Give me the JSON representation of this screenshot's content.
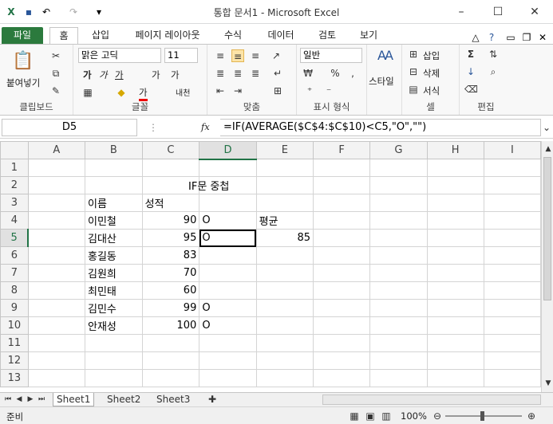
{
  "window": {
    "title": "통합 문서1  -  Microsoft Excel"
  },
  "tabs": [
    "파일",
    "홈",
    "삽입",
    "페이지 레이아웃",
    "수식",
    "데이터",
    "검토",
    "보기"
  ],
  "ribbon": {
    "clipboard": {
      "paste": "붙여넣기",
      "label": "클립보드"
    },
    "font": {
      "name": "맑은 고딕",
      "size": "11",
      "bold": "가",
      "italic": "가",
      "underline": "가",
      "grow": "가",
      "shrink": "가",
      "fontcolor": "가",
      "phonetic": "내천",
      "label": "글꼴"
    },
    "align": {
      "label": "맞춤"
    },
    "number": {
      "format": "일반",
      "label": "표시 형식"
    },
    "styles": {
      "button": "스타일"
    },
    "cells": {
      "insert": "삽입",
      "delete": "삭제",
      "format": "서식",
      "label": "셀"
    },
    "editing": {
      "label": "편집"
    }
  },
  "formula_bar": {
    "name_box": "D5",
    "fx": "fx",
    "formula": "=IF(AVERAGE($C$4:$C$10)<C5,\"O\",\"\")"
  },
  "columns": [
    "A",
    "B",
    "C",
    "D",
    "E",
    "F",
    "G",
    "H",
    "I"
  ],
  "rows": [
    {
      "n": "1",
      "cells": [
        "",
        "",
        "",
        "",
        "",
        "",
        "",
        "",
        ""
      ]
    },
    {
      "n": "2",
      "cells": [
        "",
        "",
        "IF문 중첩",
        "",
        "",
        "",
        "",
        "",
        ""
      ]
    },
    {
      "n": "3",
      "cells": [
        "",
        "이름",
        "성적",
        "",
        "",
        "",
        "",
        "",
        ""
      ]
    },
    {
      "n": "4",
      "cells": [
        "",
        "이민철",
        "90",
        "O",
        "평균",
        "",
        "",
        "",
        ""
      ]
    },
    {
      "n": "5",
      "cells": [
        "",
        "김대산",
        "95",
        "O",
        "85",
        "",
        "",
        "",
        ""
      ]
    },
    {
      "n": "6",
      "cells": [
        "",
        "홍길동",
        "83",
        "",
        "",
        "",
        "",
        "",
        ""
      ]
    },
    {
      "n": "7",
      "cells": [
        "",
        "김원희",
        "70",
        "",
        "",
        "",
        "",
        "",
        ""
      ]
    },
    {
      "n": "8",
      "cells": [
        "",
        "최민태",
        "60",
        "",
        "",
        "",
        "",
        "",
        ""
      ]
    },
    {
      "n": "9",
      "cells": [
        "",
        "김민수",
        "99",
        "O",
        "",
        "",
        "",
        "",
        ""
      ]
    },
    {
      "n": "10",
      "cells": [
        "",
        "안재성",
        "100",
        "O",
        "",
        "",
        "",
        "",
        ""
      ]
    },
    {
      "n": "11",
      "cells": [
        "",
        "",
        "",
        "",
        "",
        "",
        "",
        "",
        ""
      ]
    },
    {
      "n": "12",
      "cells": [
        "",
        "",
        "",
        "",
        "",
        "",
        "",
        "",
        ""
      ]
    },
    {
      "n": "13",
      "cells": [
        "",
        "",
        "",
        "",
        "",
        "",
        "",
        "",
        ""
      ]
    }
  ],
  "sheets": [
    "Sheet1",
    "Sheet2",
    "Sheet3"
  ],
  "status": {
    "mode": "준비",
    "zoom": "100%"
  },
  "colors": {
    "accent": "#217346",
    "file_tab": "#2b7a3d"
  }
}
